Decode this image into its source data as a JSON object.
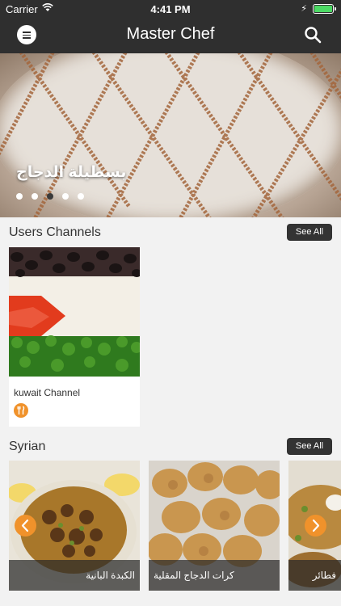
{
  "status_bar": {
    "carrier": "Carrier",
    "time": "4:41 PM"
  },
  "nav": {
    "title": "Master Chef",
    "menu_icon": "menu-icon",
    "search_icon": "search-icon"
  },
  "hero": {
    "title": "بسطيلة الدجاج",
    "slide_count": 5,
    "active_slide_index": 2
  },
  "sections": [
    {
      "title": "Users Channels",
      "see_all": "See All"
    },
    {
      "title": "Syrian",
      "see_all": "See All"
    }
  ],
  "channels": [
    {
      "name": "kuwait Channel",
      "icon": "fork-knife-icon"
    }
  ],
  "recipes": [
    {
      "title": "الكبدة البانية"
    },
    {
      "title": "كرات الدجاج المقلية"
    },
    {
      "title": "فطائر الكوسا"
    }
  ],
  "colors": {
    "bar": "#2f2f2f",
    "accent": "#f0922b",
    "background": "#f2f2f2"
  }
}
